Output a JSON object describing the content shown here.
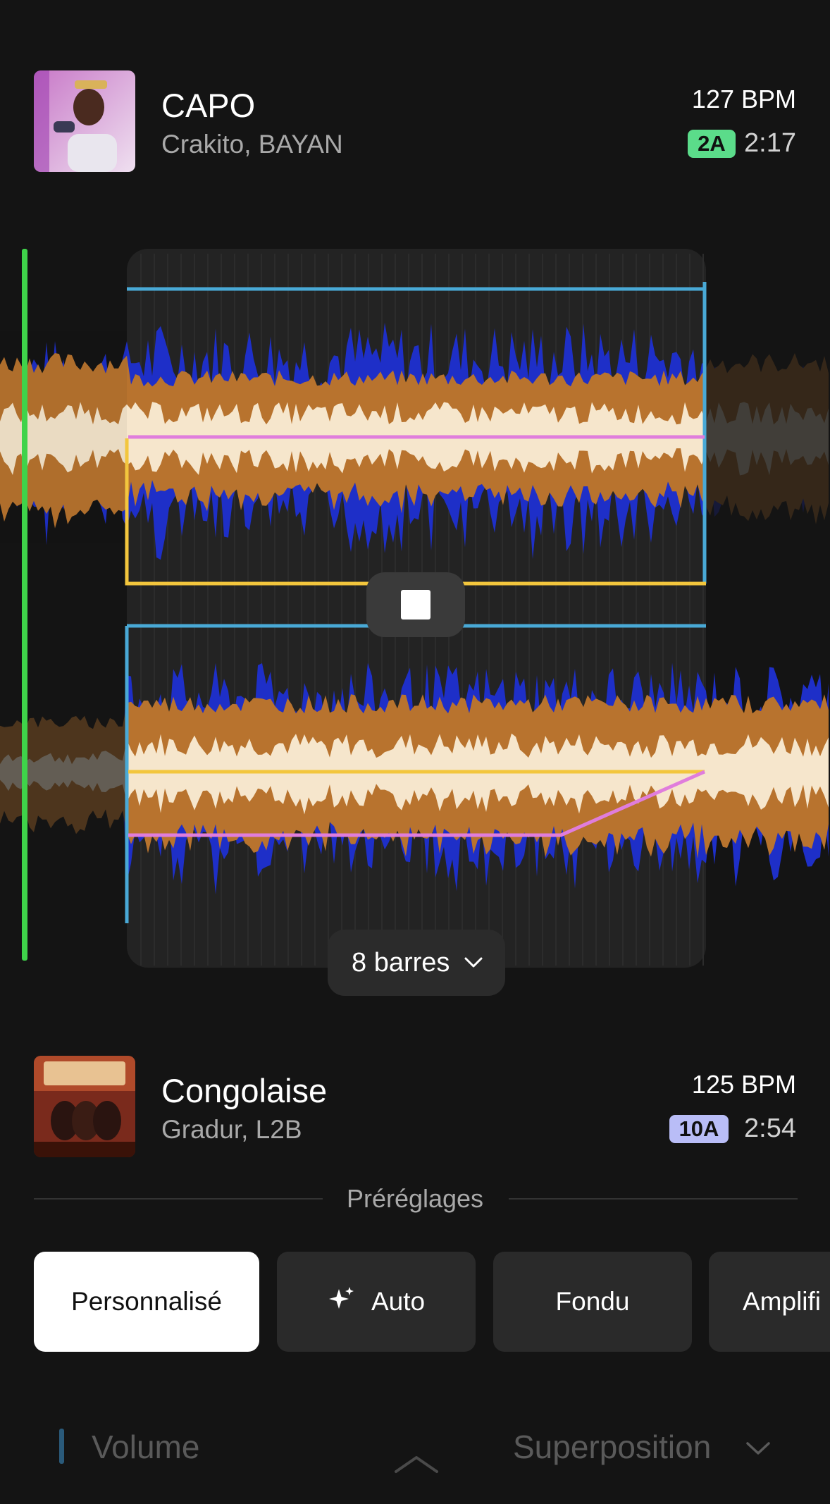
{
  "track_a": {
    "title": "CAPO",
    "artist": "Crakito, BAYAN",
    "bpm": "127 BPM",
    "key": "2A",
    "key_color": "#5bdc8a",
    "duration": "2:17"
  },
  "track_b": {
    "title": "Congolaise",
    "artist": "Gradur, L2B",
    "bpm": "125 BPM",
    "key": "10A",
    "key_color": "#b9bdf7",
    "duration": "2:54"
  },
  "transport": {
    "stop_icon": "stop-icon"
  },
  "transition": {
    "length_label": "8 barres"
  },
  "presets": {
    "label": "Préréglages",
    "items": [
      {
        "label": "Personnalisé",
        "selected": true
      },
      {
        "label": "Auto",
        "icon": "sparkle-icon"
      },
      {
        "label": "Fondu"
      },
      {
        "label": "Amplifi"
      }
    ]
  },
  "parameters": {
    "current": "Volume",
    "mode": "Superposition"
  },
  "colors": {
    "playhead": "#3fd34a",
    "high": "#1e2fc8",
    "mid": "#b8732e",
    "low": "#f6e6cc",
    "line_blue": "#49a9d6",
    "line_yellow": "#f3c63d",
    "line_pink": "#e07ddc"
  }
}
